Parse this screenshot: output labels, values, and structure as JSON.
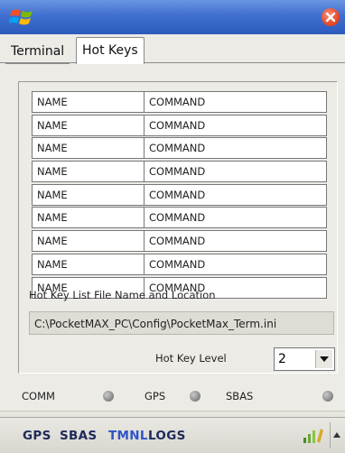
{
  "window": {
    "close_label": "close"
  },
  "tabs": [
    {
      "label": "Terminal",
      "active": false
    },
    {
      "label": "Hot Keys",
      "active": true
    }
  ],
  "hotkeys": {
    "rows": [
      {
        "name": "NAME",
        "command": "COMMAND"
      },
      {
        "name": "NAME",
        "command": "COMMAND"
      },
      {
        "name": "NAME",
        "command": "COMMAND"
      },
      {
        "name": "NAME",
        "command": "COMMAND"
      },
      {
        "name": "NAME",
        "command": "COMMAND"
      },
      {
        "name": "NAME",
        "command": "COMMAND"
      },
      {
        "name": "NAME",
        "command": "COMMAND"
      },
      {
        "name": "NAME",
        "command": "COMMAND"
      },
      {
        "name": "NAME",
        "command": "COMMAND"
      }
    ],
    "file_label": "Hot Key List File Name and Location",
    "file_path": "C:\\PocketMAX_PC\\Config\\PocketMax_Term.ini",
    "level_label": "Hot Key Level",
    "level_value": "2"
  },
  "status": {
    "comm": "COMM",
    "gps": "GPS",
    "sbas": "SBAS"
  },
  "menu": {
    "items": [
      {
        "label": "GPS"
      },
      {
        "label": "SBAS"
      },
      {
        "label": "TMNL"
      },
      {
        "label": "LOGS"
      }
    ]
  },
  "colors": {
    "titlebar": "#3f6fd0",
    "close": "#e0421f",
    "active_menu": "#2f54c8"
  },
  "icons": [
    "windows-start-icon",
    "close-icon",
    "chevron-down-icon",
    "signal-tray-icon",
    "scroll-up-icon"
  ]
}
